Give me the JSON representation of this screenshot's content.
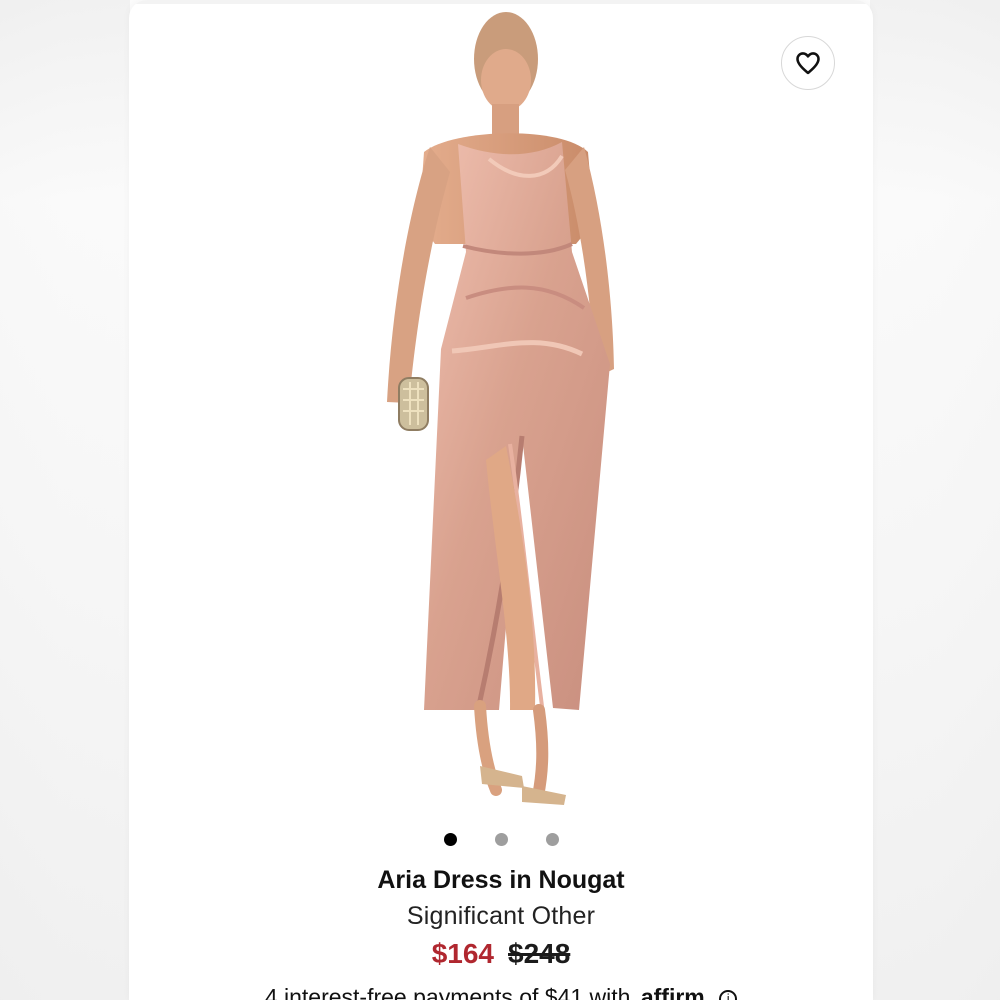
{
  "colors": {
    "sale_price": "#b0272f",
    "text": "#111111",
    "active_dot": "#000000",
    "inactive_dot": "#9e9e9e",
    "dress": "#d9a28f"
  },
  "icons": {
    "wishlist": "heart-outline-icon",
    "info": "info-icon"
  },
  "carousel": {
    "total": 3,
    "active": 1
  },
  "product": {
    "title": "Aria Dress in Nougat",
    "brand": "Significant Other",
    "sale_price": "$164",
    "original_price": "$248"
  },
  "payment": {
    "prefix": "4 interest-free payments of $41 with",
    "provider": "affirm",
    "info_symbol": "i"
  }
}
